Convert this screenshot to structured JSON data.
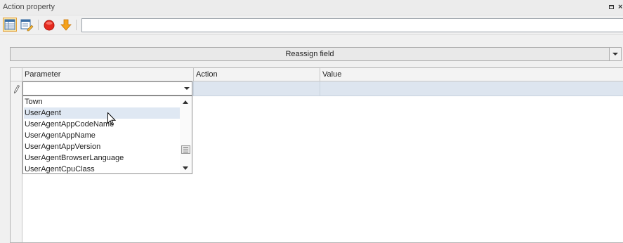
{
  "window": {
    "title": "Action property",
    "restore_icon": "restore-icon",
    "close_glyph": "×"
  },
  "toolbar": {
    "buttons": [
      {
        "name": "grid-view-icon",
        "active": true
      },
      {
        "name": "edit-list-icon",
        "active": false
      },
      {
        "name": "stop-icon",
        "active": false
      },
      {
        "name": "move-down-icon",
        "active": false
      }
    ],
    "input_value": ""
  },
  "action_selector": {
    "label": "Reassign field"
  },
  "grid": {
    "columns": [
      "Parameter",
      "Action",
      "Value"
    ],
    "row_indicator_icon": "pencil-icon",
    "rows": [
      {
        "parameter": "",
        "action": "",
        "value": ""
      }
    ]
  },
  "parameter_dropdown": {
    "current_value": "",
    "items": [
      "Town",
      "UserAgent",
      "UserAgentAppCodeName",
      "UserAgentAppName",
      "UserAgentAppVersion",
      "UserAgentBrowserLanguage",
      "UserAgentCpuClass"
    ],
    "hovered_item": "UserAgent"
  },
  "colors": {
    "selected_row": "#dde5ef",
    "hover_item": "#dfe8f3",
    "active_button": "#fde7a6",
    "stop_red": "#e52a1f",
    "arrow_orange": "#f5a21b"
  }
}
